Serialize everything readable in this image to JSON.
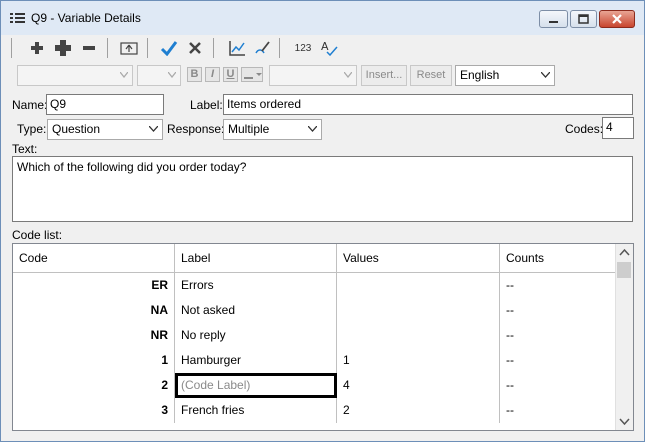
{
  "window": {
    "title": "Q9 - Variable Details"
  },
  "toolbar": {
    "insert_button": "Insert...",
    "reset_button": "Reset",
    "language_value": "English",
    "language_options": [
      "English"
    ],
    "bold": "B",
    "italic": "I",
    "underline": "U",
    "numbering": "123"
  },
  "form": {
    "name_label": "Name:",
    "name_value": "Q9",
    "label_label": "Label:",
    "label_value": "Items ordered",
    "type_label": "Type:",
    "type_value": "Question",
    "response_label": "Response:",
    "response_value": "Multiple",
    "codes_label": "Codes:",
    "codes_value": "4",
    "text_label": "Text:",
    "text_value": "Which of the following did you order today?",
    "codelist_label": "Code list:"
  },
  "grid": {
    "headers": [
      "Code",
      "Label",
      "Values",
      "Counts"
    ],
    "rows": [
      {
        "code": "ER",
        "label": "Errors",
        "values": "",
        "counts": "--"
      },
      {
        "code": "NA",
        "label": "Not asked",
        "values": "",
        "counts": "--"
      },
      {
        "code": "NR",
        "label": "No reply",
        "values": "",
        "counts": "--"
      },
      {
        "code": "1",
        "label": "Hamburger",
        "values": "1",
        "counts": "--"
      },
      {
        "code": "2",
        "label": "(Code Label)",
        "values": "4",
        "counts": "--"
      },
      {
        "code": "3",
        "label": "French fries",
        "values": "2",
        "counts": "--"
      }
    ]
  },
  "colors": {
    "accent_check": "#1f7fd1",
    "title_bar": "#dfe9f5",
    "close_button": "#c8452e"
  }
}
